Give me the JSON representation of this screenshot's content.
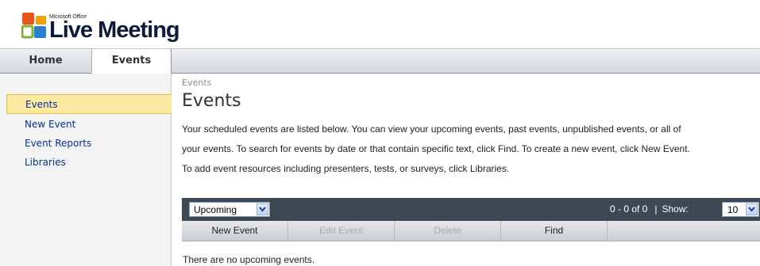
{
  "brand": {
    "office_label": "Microsoft Office",
    "product_name": "Live Meeting",
    "logo_colors": [
      "#e8541c",
      "#f2a000",
      "#7cb32b",
      "#2a7fd0"
    ]
  },
  "nav": {
    "tabs": [
      {
        "label": "Home",
        "active": false
      },
      {
        "label": "Events",
        "active": true
      }
    ]
  },
  "sidebar": {
    "items": [
      {
        "label": "Events",
        "active": true
      },
      {
        "label": "New Event",
        "active": false
      },
      {
        "label": "Event Reports",
        "active": false
      },
      {
        "label": "Libraries",
        "active": false
      }
    ]
  },
  "main": {
    "breadcrumb": "Events",
    "title": "Events",
    "description": [
      "Your scheduled events are listed below. You can view your upcoming events, past events, unpublished events, or all of",
      "your events. To search for events by date or that contain specific text, click Find. To create a new event, click New Event.",
      "To add event resources including presenters, tests, or surveys, click Libraries."
    ],
    "filter": {
      "selected": "Upcoming",
      "icon": "chevron-down-icon"
    },
    "pager": {
      "range": "0 - 0 of 0",
      "separator": "|",
      "show_label": "Show:",
      "show_value": "10"
    },
    "actions": [
      {
        "label": "New Event",
        "enabled": true
      },
      {
        "label": "Edit Event",
        "enabled": false
      },
      {
        "label": "Delete",
        "enabled": false
      },
      {
        "label": "Find",
        "enabled": true
      }
    ],
    "empty_message": "There are no upcoming events."
  }
}
